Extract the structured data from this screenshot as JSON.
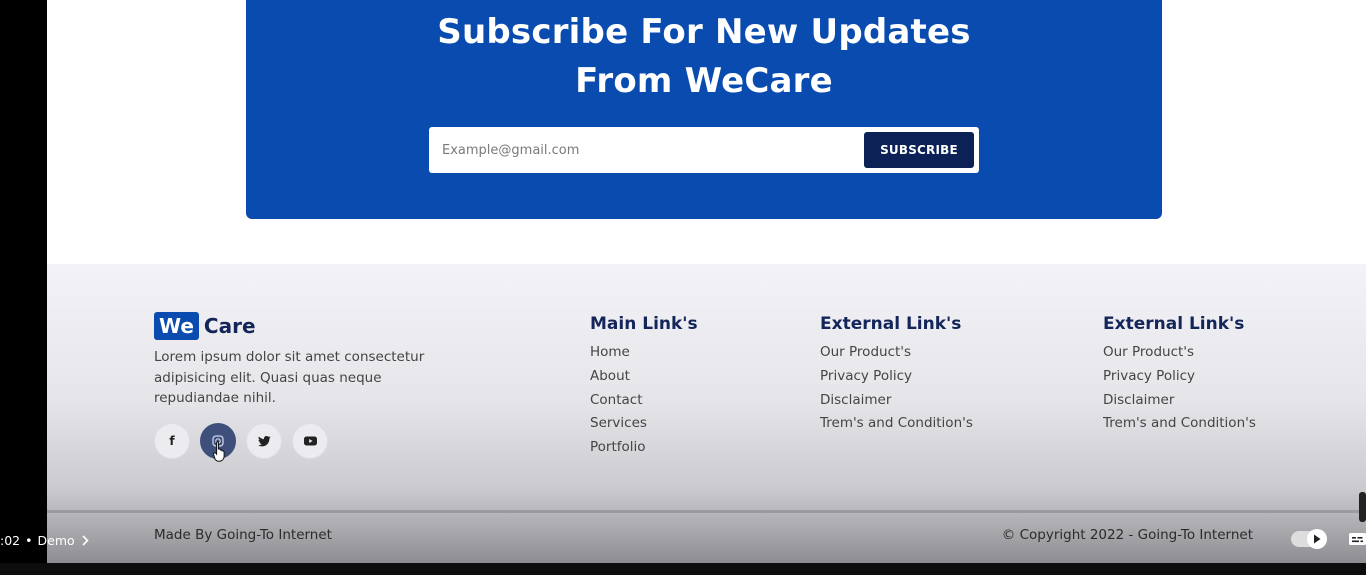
{
  "subscribe": {
    "title_line1": "Subscribe For New Updates",
    "title_line2": "From WeCare",
    "email_placeholder": "Example@gmail.com",
    "button_label": "SUBSCRIBE",
    "banner_color": "#0a4baf",
    "button_color": "#0c2257"
  },
  "footer": {
    "logo": {
      "part1": "We",
      "part2": "Care"
    },
    "about": "Lorem ipsum dolor sit amet consectetur adipisicing elit. Quasi quas neque repudiandae nihil.",
    "socials": [
      {
        "icon": "facebook-icon",
        "glyph": "f"
      },
      {
        "icon": "instagram-icon",
        "glyph": ""
      },
      {
        "icon": "twitter-icon",
        "glyph": ""
      },
      {
        "icon": "youtube-icon",
        "glyph": ""
      }
    ],
    "main_links": {
      "title": "Main Link's",
      "items": [
        "Home",
        "About",
        "Contact",
        "Services",
        "Portfolio"
      ]
    },
    "external_links_1": {
      "title": "External Link's",
      "items": [
        "Our Product's",
        "Privacy Policy",
        "Disclaimer",
        "Trem's and Condition's"
      ]
    },
    "external_links_2": {
      "title": "External Link's",
      "items": [
        "Our Product's",
        "Privacy Policy",
        "Disclaimer",
        "Trem's and Condition's"
      ]
    },
    "made_by": "Made By Going-To Internet",
    "copyright": "© Copyright 2022 - Going-To Internet"
  },
  "player": {
    "time": ":02",
    "chapter": "Demo"
  }
}
